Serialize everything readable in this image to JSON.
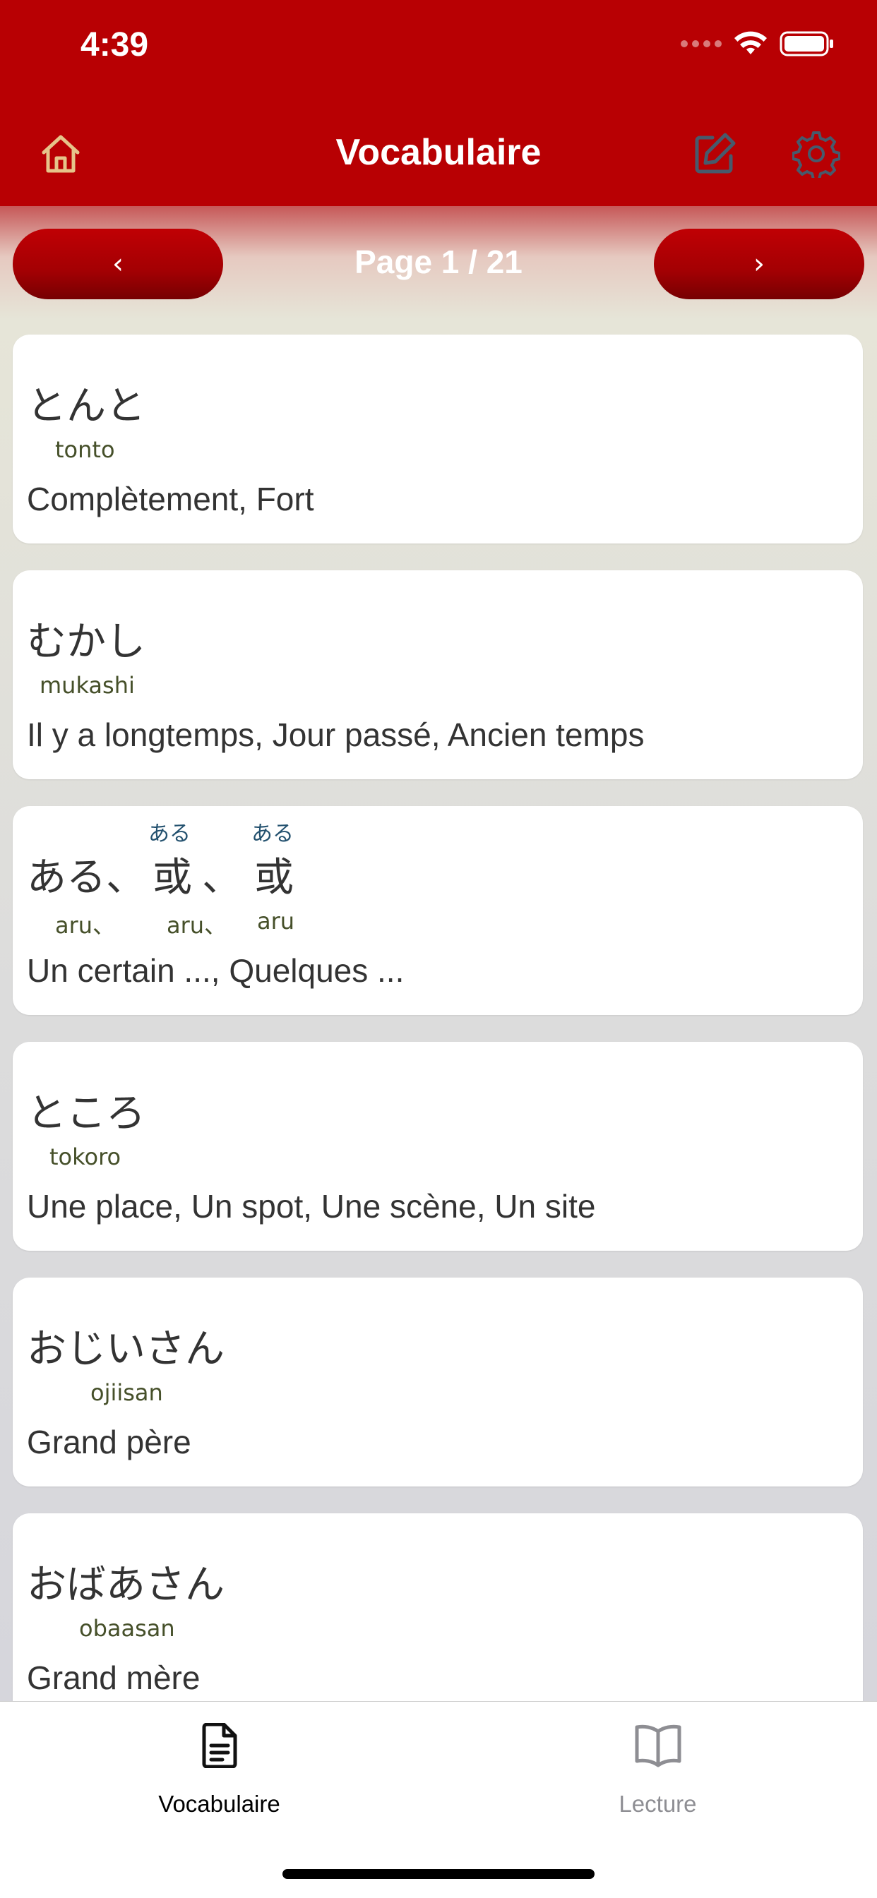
{
  "status_bar": {
    "time": "4:39"
  },
  "header": {
    "title": "Vocabulaire",
    "home_icon": "home-icon",
    "edit_icon": "edit-icon",
    "settings_icon": "gear-icon"
  },
  "pager": {
    "prev_label": "‹",
    "next_label": "›",
    "page_label": "Page 1 / 21"
  },
  "cards": [
    {
      "japanese": "とんと",
      "romaji": "tonto",
      "meaning": "Complètement, Fort"
    },
    {
      "japanese": "むかし",
      "romaji": "mukashi",
      "meaning": "Il y a longtemps, Jour passé, Ancien temps"
    },
    {
      "japanese_parts": [
        "ある、",
        "或",
        "、",
        "或"
      ],
      "furigana": [
        "ある",
        "ある"
      ],
      "romaji_parts": [
        "aru、",
        "aru、",
        "aru"
      ],
      "meaning": "Un certain ..., Quelques ..."
    },
    {
      "japanese": "ところ",
      "romaji": "tokoro",
      "meaning": "Une place, Un spot, Une scène, Un site"
    },
    {
      "japanese": "おじいさん",
      "romaji": "ojiisan",
      "meaning": "Grand père"
    },
    {
      "japanese": "おばあさん",
      "romaji": "obaasan",
      "meaning": "Grand mère"
    }
  ],
  "tabs": [
    {
      "label": "Vocabulaire",
      "icon": "document-icon",
      "active": true
    },
    {
      "label": "Lecture",
      "icon": "book-icon",
      "active": false
    }
  ],
  "colors": {
    "brand": "#b80003",
    "accent_icon": "#e6c48a",
    "header_icon": "#475a6c",
    "tab_inactive": "#8e8e93"
  }
}
